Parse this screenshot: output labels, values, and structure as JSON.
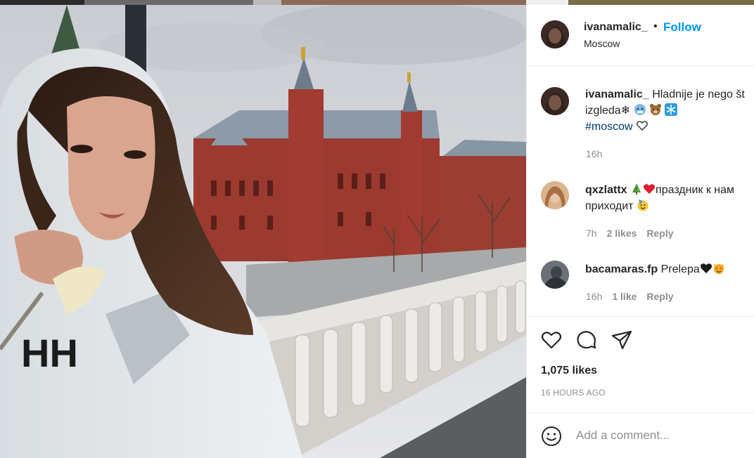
{
  "header": {
    "username": "ivanamalic_",
    "separator": "•",
    "follow_label": "Follow",
    "location": "Moscow"
  },
  "caption": {
    "username": "ivanamalic_",
    "text_line1": "Hladnije je nego št",
    "text_line2": "izgleda❄",
    "hashtag": "#moscow",
    "time": "16h"
  },
  "comments": [
    {
      "username": "qxzlattx",
      "text_line1": "праздник к нам",
      "text_line2": "приходит",
      "time": "7h",
      "likes": "2 likes",
      "reply": "Reply"
    },
    {
      "username": "bacamaras.fp",
      "text": "Prelepa",
      "time": "16h",
      "likes": "1 like",
      "reply": "Reply"
    }
  ],
  "actions": {
    "like_icon": "heart-icon",
    "comment_icon": "comment-icon",
    "share_icon": "paper-plane-icon"
  },
  "likes_count": "1,075 likes",
  "time_ago": "16 HOURS AGO",
  "add_comment": {
    "placeholder": "Add a comment..."
  },
  "colors": {
    "follow": "#0095f6",
    "meta": "#8e8e8e",
    "hashtag": "#00376b"
  }
}
